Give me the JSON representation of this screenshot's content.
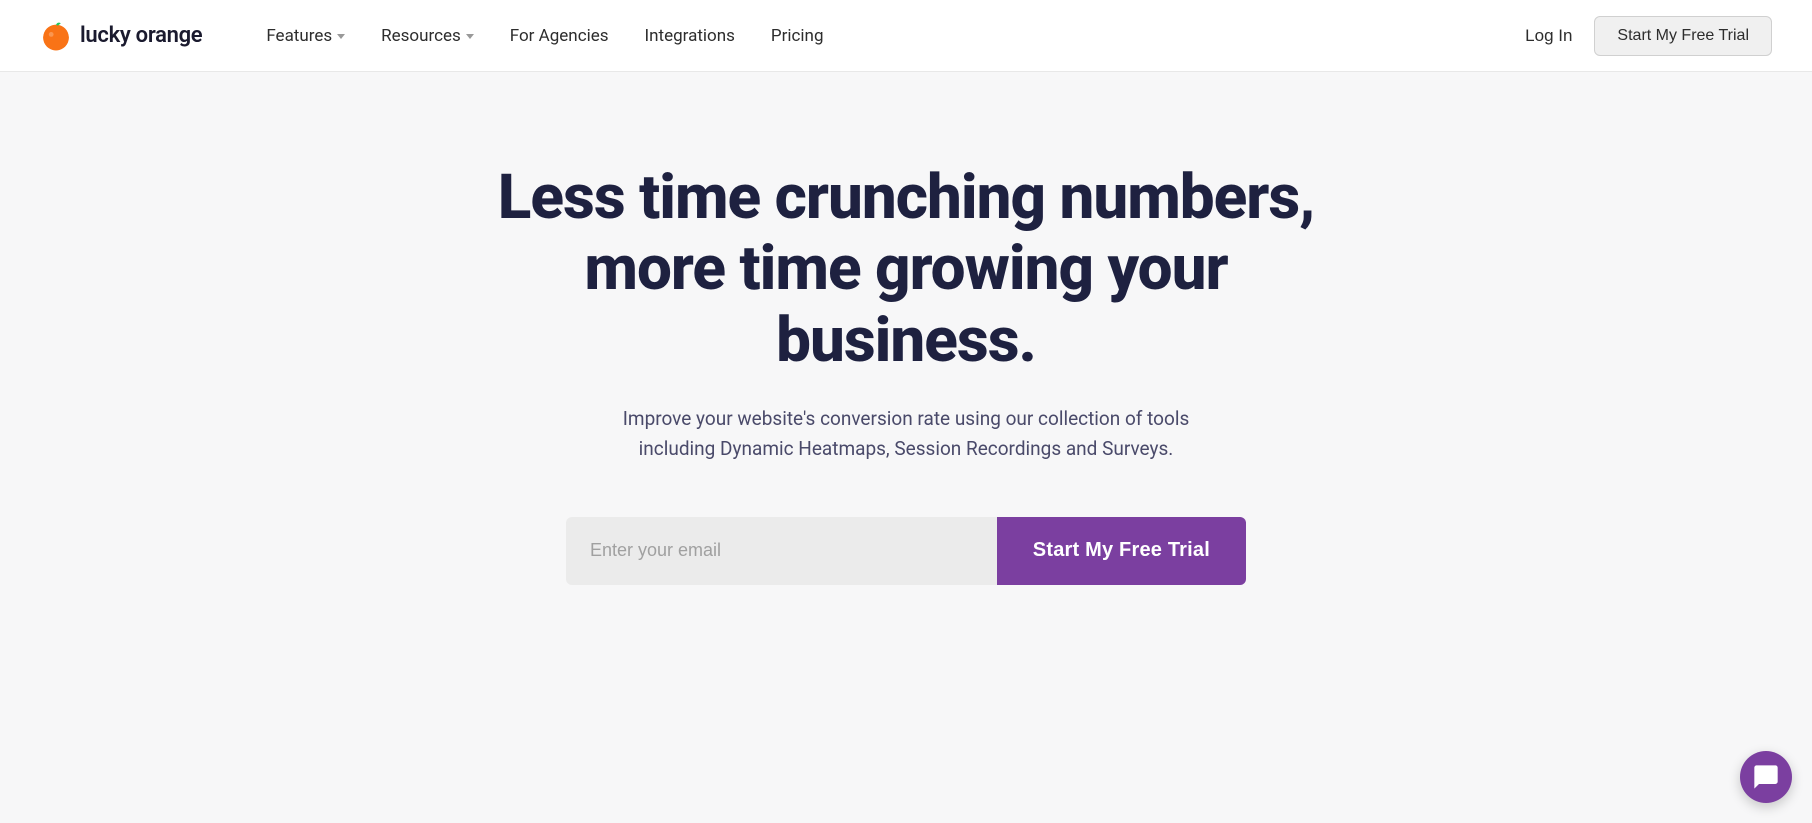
{
  "brand": {
    "name": "lucky orange",
    "logo_alt": "Lucky Orange logo"
  },
  "nav": {
    "features_label": "Features",
    "resources_label": "Resources",
    "for_agencies_label": "For Agencies",
    "integrations_label": "Integrations",
    "pricing_label": "Pricing",
    "login_label": "Log In",
    "trial_label": "Start My Free Trial"
  },
  "hero": {
    "headline_line1": "Less time crunching numbers,",
    "headline_line2": "more time growing your business.",
    "subheadline": "Improve your website's conversion rate using our collection of tools including Dynamic Heatmaps, Session Recordings and Surveys.",
    "email_placeholder": "Enter your email",
    "cta_label": "Start My Free Trial"
  },
  "colors": {
    "brand_purple": "#7b3fa0",
    "nav_bg": "#ffffff",
    "hero_bg": "#f7f7f8",
    "headline_color": "#1e2140",
    "sub_color": "#4a4a6a"
  }
}
